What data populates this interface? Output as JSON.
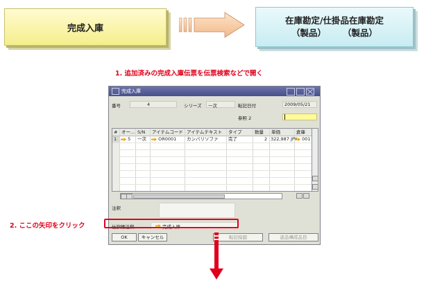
{
  "flow": {
    "left_box": "完成入庫",
    "right_box_line1": "在庫勘定/仕掛品在庫勘定",
    "right_box_sub1": "（製品）",
    "right_box_sub2": "（製品）"
  },
  "instructions": {
    "step1": "1. 追加済みの完成入庫伝票を伝票検索などで開く",
    "step2": "2. ここの矢印をクリック"
  },
  "window": {
    "title": "完成入庫",
    "header": {
      "number_label": "番号",
      "number_value": "4",
      "series_label": "シリーズ",
      "series_value": "一次",
      "posting_date_label": "転記日付",
      "posting_date_value": "2009/05/21",
      "ref2_label": "参照 2",
      "ref2_value": ""
    },
    "grid": {
      "columns": [
        "#",
        "オー...",
        "S/N",
        "アイテムコード",
        "アイテムテキスト",
        "タイプ",
        "数量",
        "単価",
        "倉庫"
      ],
      "rows": [
        {
          "num": "1",
          "order": "5",
          "sn": "一次",
          "item_code": "OR0001",
          "item_text": "カンバリソファ",
          "type": "完了",
          "qty": "2",
          "unit_price": "322,987 JPY",
          "warehouse": "001"
        }
      ]
    },
    "remarks_label": "注釈",
    "journal_label": "仕訳帳注釈",
    "journal_value": "完成入庫",
    "buttons": {
      "ok": "OK",
      "cancel": "キャンセル",
      "copy_from": "転記指図",
      "copy_to": "返品構成品目"
    }
  },
  "colors": {
    "instruction_red": "#e0001b",
    "title_blue": "#4f5892",
    "left_box_yellow": "#f5ee8c",
    "right_box_cyan": "#c8ecf2",
    "link_arrow_orange": "#f2a200"
  }
}
